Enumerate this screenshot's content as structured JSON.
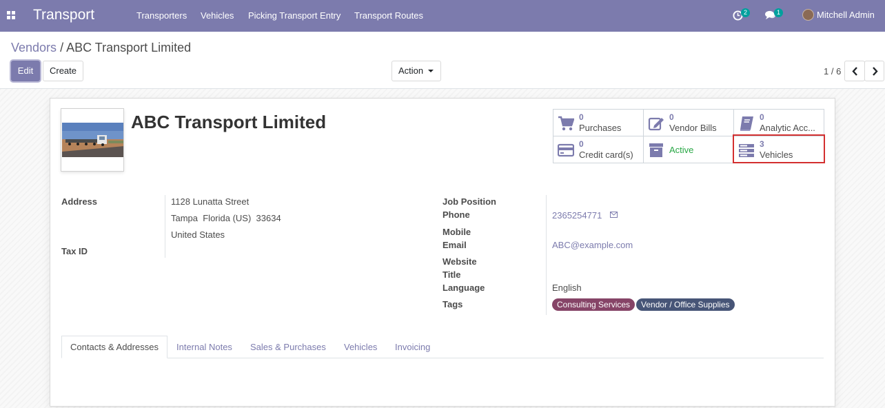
{
  "navbar": {
    "brand": "Transport",
    "menu": [
      "Transporters",
      "Vehicles",
      "Picking Transport Entry",
      "Transport Routes"
    ],
    "activity_count": "2",
    "messages_count": "1",
    "user": "Mitchell Admin"
  },
  "breadcrumb": {
    "parent": "Vendors",
    "separator": "/",
    "current": "ABC Transport Limited"
  },
  "buttons": {
    "edit": "Edit",
    "create": "Create",
    "action": "Action"
  },
  "pager": {
    "text": "1 / 6"
  },
  "partner": {
    "name": "ABC Transport Limited"
  },
  "smart_buttons": [
    {
      "value": "0",
      "label": "Purchases",
      "icon": "shopping-cart-icon"
    },
    {
      "value": "0",
      "label": "Vendor Bills",
      "icon": "pencil-square-icon"
    },
    {
      "value": "0",
      "label": "Analytic Acc...",
      "icon": "book-icon"
    },
    {
      "value": "0",
      "label": "Credit card(s)",
      "icon": "credit-card-icon"
    },
    {
      "value": "",
      "label": "Active",
      "icon": "archive-icon"
    },
    {
      "value": "3",
      "label": "Vehicles",
      "icon": "server-icon"
    }
  ],
  "fields_left": {
    "address_label": "Address",
    "street": "1128 Lunatta Street",
    "city_line": "Tampa  Florida (US)  33634",
    "country": "United States",
    "tax_label": "Tax ID"
  },
  "fields_right": {
    "job_label": "Job Position",
    "phone_label": "Phone",
    "phone": "2365254771",
    "mobile_label": "Mobile",
    "email_label": "Email",
    "email": "ABC@example.com",
    "website_label": "Website",
    "title_label": "Title",
    "language_label": "Language",
    "language": "English",
    "tags_label": "Tags",
    "tags": [
      {
        "name": "Consulting Services",
        "color": "#864467"
      },
      {
        "name": "Vendor / Office Supplies",
        "color": "#475577"
      }
    ]
  },
  "tabs": [
    "Contacts & Addresses",
    "Internal Notes",
    "Sales & Purchases",
    "Vehicles",
    "Invoicing"
  ],
  "colors": {
    "brand": "#7c7bad",
    "active": "#28a745",
    "highlight": "#d32f2f"
  }
}
